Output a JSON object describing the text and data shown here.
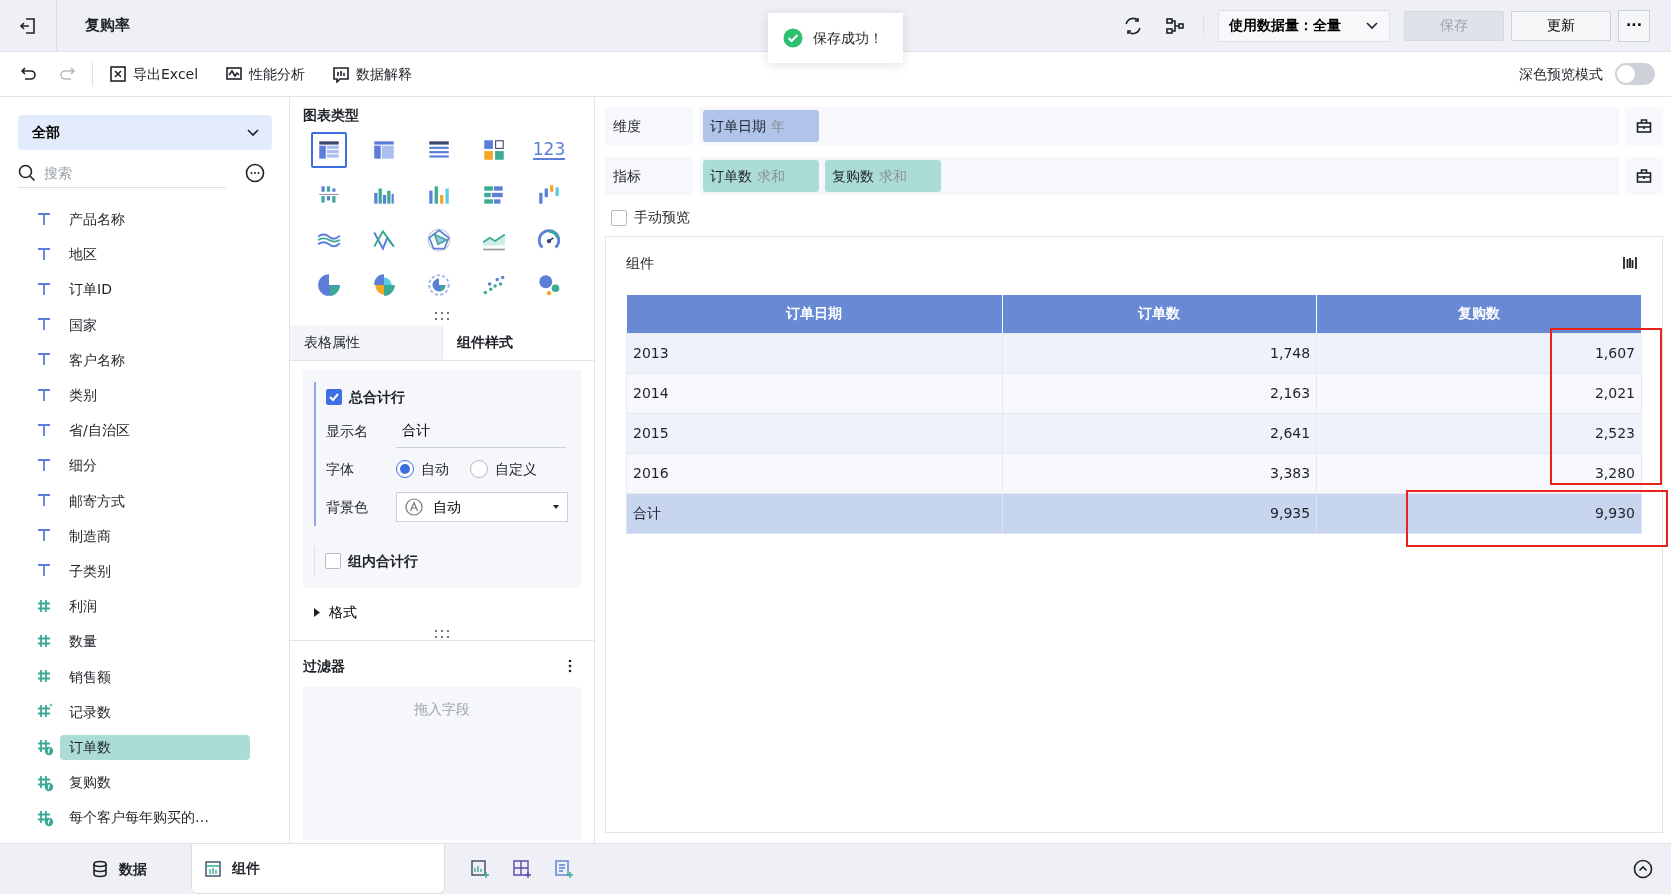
{
  "header": {
    "title": "复购率",
    "data_volume": "使用数据量：全量",
    "buttons": [
      {
        "label": "保存",
        "disabled": true
      },
      {
        "label": "更新",
        "disabled": false
      }
    ],
    "more": "···"
  },
  "toast": {
    "message": "保存成功！"
  },
  "toolbar": {
    "items": [
      "导出Excel",
      "性能分析",
      "数据解释"
    ],
    "dark_preview": {
      "label": "深色预览模式",
      "on": false
    }
  },
  "fields_panel": {
    "dropdown": "全部",
    "search_placeholder": "搜索",
    "fields": [
      {
        "label": "产品名称",
        "kind": "text",
        "selected": false
      },
      {
        "label": "地区",
        "kind": "text",
        "selected": false
      },
      {
        "label": "订单ID",
        "kind": "text",
        "selected": false
      },
      {
        "label": "国家",
        "kind": "text",
        "selected": false
      },
      {
        "label": "客户名称",
        "kind": "text",
        "selected": false
      },
      {
        "label": "类别",
        "kind": "text",
        "selected": false
      },
      {
        "label": "省/自治区",
        "kind": "text",
        "selected": false
      },
      {
        "label": "细分",
        "kind": "text",
        "selected": false
      },
      {
        "label": "邮寄方式",
        "kind": "text",
        "selected": false
      },
      {
        "label": "制造商",
        "kind": "text",
        "selected": false
      },
      {
        "label": "子类别",
        "kind": "text",
        "selected": false
      },
      {
        "label": "利润",
        "kind": "number",
        "selected": false
      },
      {
        "label": "数量",
        "kind": "number",
        "selected": false
      },
      {
        "label": "销售额",
        "kind": "number",
        "selected": false
      },
      {
        "label": "记录数",
        "kind": "count",
        "selected": false
      },
      {
        "label": "订单数",
        "kind": "calc",
        "selected": true
      },
      {
        "label": "复购数",
        "kind": "calc",
        "selected": false
      },
      {
        "label": "每个客户每年购买的…",
        "kind": "calc",
        "selected": false
      }
    ]
  },
  "chart_types": {
    "title": "图表类型",
    "items": [
      {
        "selected": true
      },
      {
        "selected": false
      },
      {
        "selected": false
      },
      {
        "selected": false
      },
      {
        "selected": false,
        "text": "123"
      },
      {
        "selected": false
      },
      {
        "selected": false
      },
      {
        "selected": false
      },
      {
        "selected": false
      },
      {
        "selected": false
      },
      {
        "selected": false
      },
      {
        "selected": false
      },
      {
        "selected": false
      },
      {
        "selected": false
      },
      {
        "selected": false
      },
      {
        "selected": false
      },
      {
        "selected": false
      },
      {
        "selected": false
      },
      {
        "selected": false
      },
      {
        "selected": false
      }
    ]
  },
  "style_tabs": [
    {
      "label": "表格属性",
      "selected": false
    },
    {
      "label": "组件样式",
      "selected": true
    }
  ],
  "total_row": {
    "label": "总合计行",
    "checked": true,
    "display_name_label": "显示名",
    "display_name": "合计",
    "font_label": "字体",
    "font_options": [
      {
        "label": "自动",
        "selected": true
      },
      {
        "label": "自定义",
        "selected": false
      }
    ],
    "bg_label": "背景色",
    "bg_value": "自动"
  },
  "group_total": {
    "label": "组内合计行",
    "checked": false
  },
  "format": {
    "label": "格式",
    "expanded": false
  },
  "filter": {
    "title": "过滤器",
    "placeholder": "拖入字段"
  },
  "dimension": {
    "label": "维度",
    "pills": [
      {
        "name": "订单日期",
        "suffix": "年"
      }
    ]
  },
  "measure": {
    "label": "指标",
    "pills": [
      {
        "name": "订单数",
        "suffix": "求和"
      },
      {
        "name": "复购数",
        "suffix": "求和"
      }
    ]
  },
  "manual_preview": {
    "label": "手动预览",
    "checked": false
  },
  "widget": {
    "title": "组件",
    "table": {
      "columns": [
        "订单日期",
        "订单数",
        "复购数"
      ],
      "rows": [
        [
          "2013",
          "1,748",
          "1,607"
        ],
        [
          "2014",
          "2,163",
          "2,021"
        ],
        [
          "2015",
          "2,641",
          "2,523"
        ],
        [
          "2016",
          "3,383",
          "3,280"
        ]
      ],
      "total": [
        "合计",
        "9,935",
        "9,930"
      ]
    }
  },
  "bottom_tabs": [
    {
      "label": "数据",
      "selected": false
    },
    {
      "label": "组件",
      "selected": true
    }
  ]
}
